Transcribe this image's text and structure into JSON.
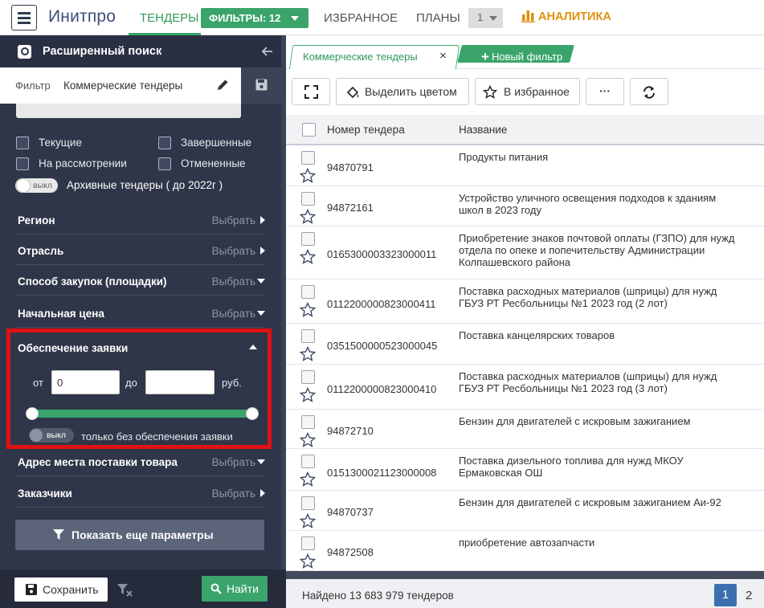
{
  "topbar": {
    "logo": "Инитпро",
    "nav_tenders": "ТЕНДЕРЫ",
    "filters_button": "ФИЛЬТРЫ: 12",
    "nav_favorites": "ИЗБРАННОЕ",
    "nav_plans": "ПЛАНЫ",
    "plans_select_value": "1",
    "nav_analytics": "АНАЛИТИКА",
    "accent_color": "#3aa46b",
    "analytics_color": "#e0900f"
  },
  "sidebar": {
    "title": "Расширенный поиск",
    "filter_label": "Фильтр",
    "filter_value": "Коммерческие тендеры",
    "status_checkboxes": [
      {
        "label": "Текущие",
        "checked": false
      },
      {
        "label": "Завершенные",
        "checked": false
      },
      {
        "label": "На рассмотрении",
        "checked": false
      },
      {
        "label": "Отмененные",
        "checked": false
      }
    ],
    "archive_toggle": {
      "state": "выкл",
      "label": "Архивные тендеры ( до 2022г )"
    },
    "pick_label": "Выбрать",
    "sections": {
      "region": "Регион",
      "industry": "Отрасль",
      "procurement": "Способ закупок (площадки)",
      "start_price": "Начальная цена",
      "delivery_address": "Адрес места поставки товара",
      "customers": "Заказчики"
    },
    "guarantee": {
      "title": "Обеспечение заявки",
      "from_label": "от",
      "from_value": "0",
      "to_label": "до",
      "to_value": "",
      "unit": "руб.",
      "toggle_state": "выкл",
      "toggle_label": "только без обеспечения заявки"
    },
    "more_params_button": "Показать еще параметры",
    "save_button": "Сохранить",
    "find_button": "Найти"
  },
  "tabs": {
    "active": "Коммерческие тендеры",
    "close": "×",
    "new_tab": "Новый фильтр",
    "new_tab_plus": "+"
  },
  "toolbar": {
    "highlight": "Выделить цветом",
    "favorite": "В избранное",
    "more": "···"
  },
  "table": {
    "columns": [
      "Номер тендера",
      "Название"
    ],
    "rows": [
      {
        "number": "94870791",
        "name": [
          "Продукты питания"
        ]
      },
      {
        "number": "94872161",
        "name": [
          "Устройство уличного освещения подходов к зданиям",
          "школ в 2023 году"
        ]
      },
      {
        "number": "0165300003323000011",
        "name": [
          "Приобретение знаков почтовой оплаты (ГЗПО) для нужд",
          "отдела по опеке и попечительству Администрации",
          "Колпашевского района"
        ]
      },
      {
        "number": "0112200000823000411",
        "name": [
          "Поставка расходных материалов (шприцы) для нужд",
          "ГБУЗ РТ Ресбольницы №1 2023 год (2 лот)"
        ]
      },
      {
        "number": "0351500000523000045",
        "name": [
          "Поставка канцелярских товаров"
        ]
      },
      {
        "number": "0112200000823000410",
        "name": [
          "Поставка расходных материалов (шприцы) для нужд",
          "ГБУЗ РТ Ресбольницы №1 2023 год (3 лот)"
        ]
      },
      {
        "number": "94872710",
        "name": [
          "Бензин для двигателей с искровым зажиганием"
        ]
      },
      {
        "number": "0151300021123000008",
        "name": [
          "Поставка дизельного топлива для нужд МКОУ",
          "Ермаковская ОШ"
        ]
      },
      {
        "number": "94870737",
        "name": [
          "Бензин для двигателей с искровым зажиганием Аи-92"
        ]
      },
      {
        "number": "94872508",
        "name": [
          "приобретение автозапчасти"
        ]
      }
    ]
  },
  "status": {
    "found_text": "Найдено 13 683 979 тендеров",
    "pages": [
      "1",
      "2"
    ],
    "current_page": "1"
  }
}
